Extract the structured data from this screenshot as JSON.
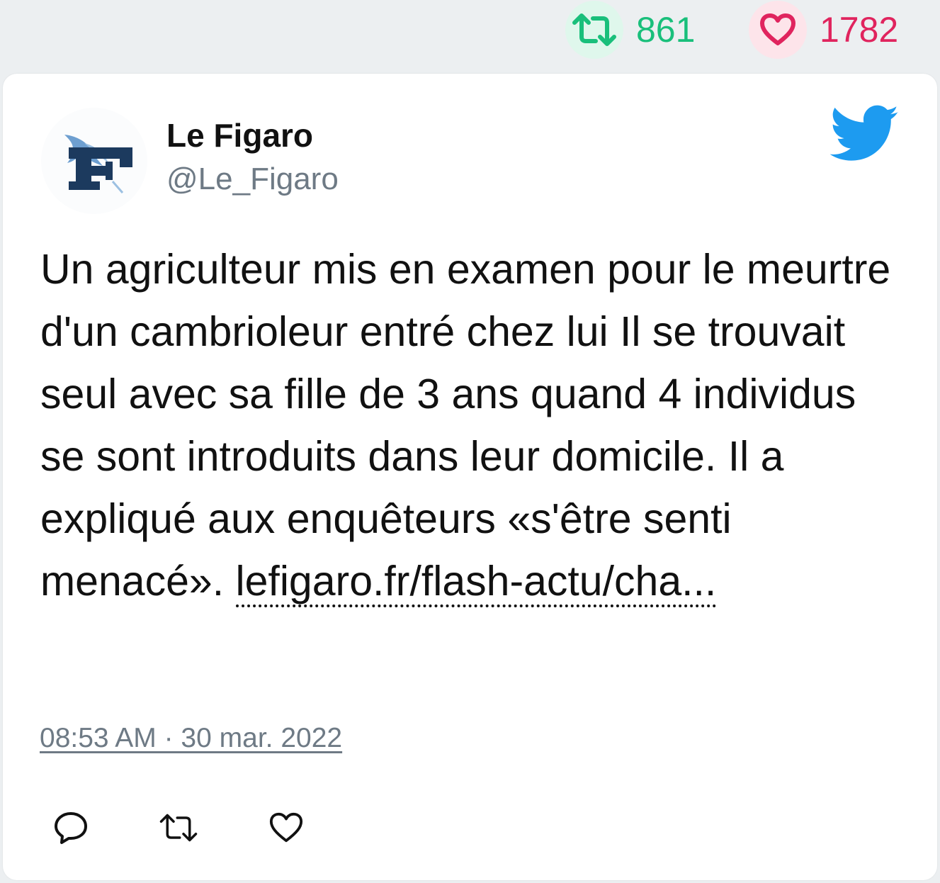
{
  "stats": {
    "retweet_count": "861",
    "like_count": "1782",
    "retweet_icon": "retweet-icon",
    "like_icon": "heart-icon"
  },
  "author": {
    "name": "Le Figaro",
    "handle": "@Le_Figaro",
    "avatar_icon": "le-figaro-logo"
  },
  "tweet": {
    "text": "Un agriculteur mis en examen pour le meurtre d'un cambrioleur entré chez lui Il se trouvait seul avec sa fille de 3 ans quand 4 individus se sont introduits dans leur domicile. Il a expliqué aux enquêteurs «s'être senti menacé». ",
    "link": "lefigaro.fr/flash-actu/cha...",
    "timestamp": "08:53 AM · 30 mar. 2022"
  },
  "actions": {
    "reply_icon": "reply-icon",
    "retweet_icon": "retweet-icon",
    "like_icon": "heart-icon"
  },
  "colors": {
    "retweet_green": "#19bf7b",
    "like_red": "#e0245e",
    "twitter_blue": "#1d9bf0",
    "figaro_navy": "#1c3a5e",
    "muted_gray": "#6e7a85"
  }
}
